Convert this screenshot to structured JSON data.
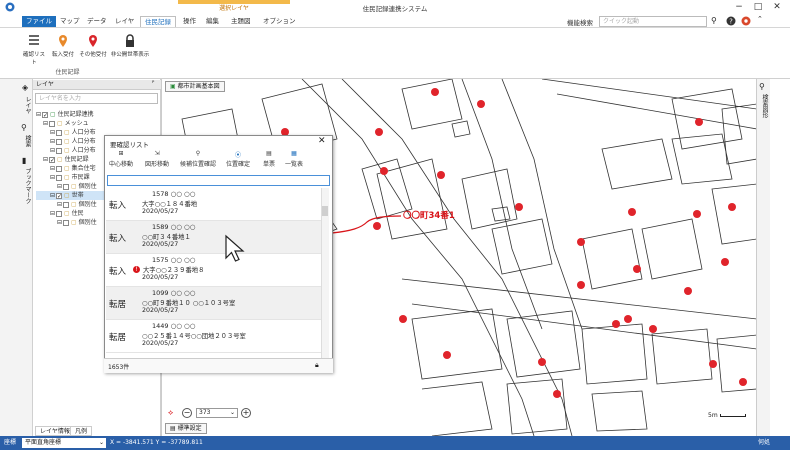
{
  "window": {
    "title": "住民記録連携システム",
    "context_tab": "選択レイヤ",
    "controls": [
      "−",
      "□",
      "✕"
    ]
  },
  "menu": {
    "items": [
      "ファイル",
      "マップ",
      "データ",
      "レイヤ",
      "住民記録",
      "操作",
      "編集",
      "主題図",
      "オプション"
    ],
    "search_label": "機能検索",
    "search_placeholder": "クイック起動"
  },
  "ribbon": {
    "buttons": [
      "確認リスト",
      "転入受付",
      "その他受付",
      "非公開世帯表示"
    ],
    "group_label": "住民記録"
  },
  "left_strip": {
    "labels": [
      "レイヤ",
      "検索",
      "ブックマーク"
    ]
  },
  "layer_panel": {
    "header": "レイヤ",
    "pin": "ᴾ",
    "search_placeholder": "レイヤ名を入力",
    "tree": [
      {
        "label": "住民記録連携",
        "indent": 0,
        "checked": true
      },
      {
        "label": "メッシュ",
        "indent": 1,
        "checked": false
      },
      {
        "label": "人口分布",
        "indent": 2,
        "checked": false
      },
      {
        "label": "人口分布",
        "indent": 2,
        "checked": false
      },
      {
        "label": "人口分布",
        "indent": 2,
        "checked": false
      },
      {
        "label": "住民記録",
        "indent": 1,
        "checked": true
      },
      {
        "label": "集合住宅",
        "indent": 2,
        "checked": false
      },
      {
        "label": "市民課",
        "indent": 2,
        "checked": false
      },
      {
        "label": "個別住",
        "indent": 3,
        "checked": false
      },
      {
        "label": "世帯",
        "indent": 2,
        "checked": true
      },
      {
        "label": "個別住",
        "indent": 3,
        "checked": false
      },
      {
        "label": "住民",
        "indent": 2,
        "checked": false
      },
      {
        "label": "個別住",
        "indent": 3,
        "checked": false
      }
    ],
    "tabs": [
      "レイヤ情報",
      "凡例"
    ]
  },
  "map": {
    "tab_label": "都市計画基本図",
    "callout": "〇〇町34番1",
    "zoom_value": "373",
    "scale_label": "5m",
    "std_tab": "標準設定",
    "right_strip_label": "検索図形"
  },
  "popup": {
    "title": "要確認リスト",
    "close": "✕",
    "tools": [
      "中心移動",
      "図形移動",
      "候補位置確認",
      "位置確定",
      "単票",
      "一覧表"
    ],
    "records": [
      {
        "type": "転入",
        "number": "1578 ○○ ○○",
        "address": "大字○○１８４番地",
        "date": "2020/05/27",
        "warn": false
      },
      {
        "type": "転入",
        "number": "1589 ○○ ○○",
        "address": "○○町３４番地１",
        "date": "2020/05/27",
        "warn": false
      },
      {
        "type": "転入",
        "number": "1575 ○○ ○○",
        "address": "大字○○２３９番地８",
        "date": "2020/05/27",
        "warn": true
      },
      {
        "type": "転居",
        "number": "1099 ○○ ○○",
        "address": "○○町９番地１０ ○○１０３号室",
        "date": "2020/05/27",
        "warn": false
      },
      {
        "type": "転居",
        "number": "1449 ○○ ○○",
        "address": "○○２５番１４号○○団地２０３号室",
        "date": "2020/05/27",
        "warn": false
      }
    ],
    "count": "1653件"
  },
  "statusbar": {
    "label": "座標",
    "crs": "平面直角座標",
    "coords": "X = -3841.571 Y = -37789.811",
    "right": "何処"
  },
  "colors": {
    "accent": "#1e6fbd",
    "status": "#2a5fa8",
    "marker": "#e0242b",
    "callout": "#d9151a"
  }
}
